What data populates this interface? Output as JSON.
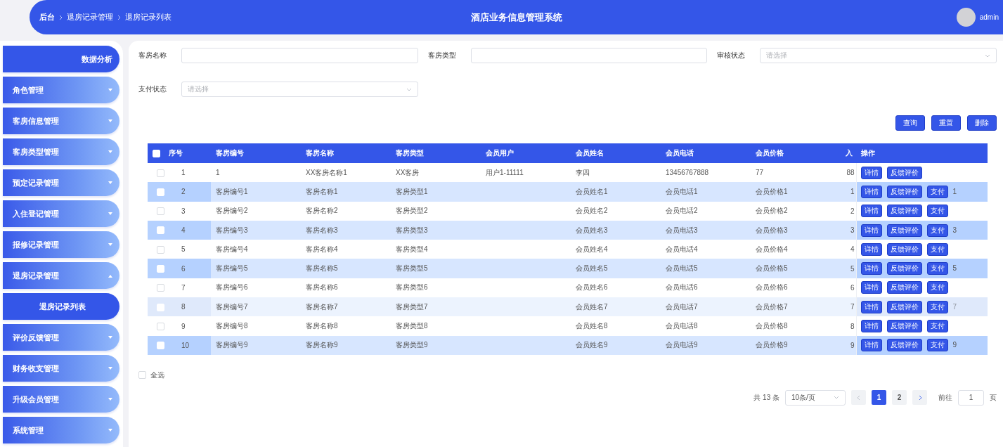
{
  "header": {
    "breadcrumbs": [
      "后台",
      "退房记录管理",
      "退房记录列表"
    ],
    "title": "酒店业务信息管理系统",
    "user": "admin"
  },
  "sidebar": {
    "items": [
      {
        "label": "数据分析",
        "kind": "link",
        "selected": false
      },
      {
        "label": "角色管理",
        "kind": "group",
        "expanded": false
      },
      {
        "label": "客房信息管理",
        "kind": "group",
        "expanded": false
      },
      {
        "label": "客房类型管理",
        "kind": "group",
        "expanded": false
      },
      {
        "label": "预定记录管理",
        "kind": "group",
        "expanded": false
      },
      {
        "label": "入住登记管理",
        "kind": "group",
        "expanded": false
      },
      {
        "label": "报修记录管理",
        "kind": "group",
        "expanded": false
      },
      {
        "label": "退房记录管理",
        "kind": "group",
        "expanded": true,
        "children": [
          {
            "label": "退房记录列表",
            "selected": true
          }
        ]
      },
      {
        "label": "评价反馈管理",
        "kind": "group",
        "expanded": false
      },
      {
        "label": "财务收支管理",
        "kind": "group",
        "expanded": false
      },
      {
        "label": "升级会员管理",
        "kind": "group",
        "expanded": false
      },
      {
        "label": "系统管理",
        "kind": "group",
        "expanded": false
      }
    ]
  },
  "filters": [
    {
      "label": "客房名称",
      "kind": "input"
    },
    {
      "label": "客房类型",
      "kind": "input"
    },
    {
      "label": "审核状态",
      "kind": "select",
      "placeholder": "请选择"
    },
    {
      "label": "支付状态",
      "kind": "select",
      "placeholder": "请选择"
    }
  ],
  "actions": [
    "查询",
    "重置",
    "删除"
  ],
  "table": {
    "all_checked": false,
    "columns": [
      "序号",
      "客房编号",
      "客房名称",
      "客房类型",
      "会员用户",
      "会员姓名",
      "会员电话",
      "会员价格",
      "入",
      "操作"
    ],
    "rows": [
      {
        "seq": "1",
        "room_no": "1",
        "room_name": "XX客房名称1",
        "room_type": "XX客房",
        "member_user": "用户1-11111",
        "member_name": "李四",
        "member_phone": "13456767888",
        "member_price": "77",
        "check_in": "88",
        "buttons": [
          "详情",
          "反馈评价"
        ],
        "highlighted": false,
        "hovered": false
      },
      {
        "seq": "2",
        "room_no": "客房编号1",
        "room_name": "客房名称1",
        "room_type": "客房类型1",
        "member_name": "会员姓名1",
        "member_phone": "会员电话1",
        "member_price": "会员价格1",
        "check_in": "1",
        "buttons": [
          "详情",
          "反馈评价",
          "支付"
        ],
        "tail": "1",
        "highlighted": true,
        "hovered": false
      },
      {
        "seq": "3",
        "room_no": "客房编号2",
        "room_name": "客房名称2",
        "room_type": "客房类型2",
        "member_name": "会员姓名2",
        "member_phone": "会员电话2",
        "member_price": "会员价格2",
        "check_in": "2",
        "buttons": [
          "详情",
          "反馈评价",
          "支付"
        ],
        "highlighted": false,
        "hovered": false
      },
      {
        "seq": "4",
        "room_no": "客房编号3",
        "room_name": "客房名称3",
        "room_type": "客房类型3",
        "member_name": "会员姓名3",
        "member_phone": "会员电话3",
        "member_price": "会员价格3",
        "check_in": "3",
        "buttons": [
          "详情",
          "反馈评价",
          "支付"
        ],
        "tail": "3",
        "highlighted": true,
        "hovered": false
      },
      {
        "seq": "5",
        "room_no": "客房编号4",
        "room_name": "客房名称4",
        "room_type": "客房类型4",
        "member_name": "会员姓名4",
        "member_phone": "会员电话4",
        "member_price": "会员价格4",
        "check_in": "4",
        "buttons": [
          "详情",
          "反馈评价",
          "支付"
        ],
        "highlighted": false,
        "hovered": false
      },
      {
        "seq": "6",
        "room_no": "客房编号5",
        "room_name": "客房名称5",
        "room_type": "客房类型5",
        "member_name": "会员姓名5",
        "member_phone": "会员电话5",
        "member_price": "会员价格5",
        "check_in": "5",
        "buttons": [
          "详情",
          "反馈评价",
          "支付"
        ],
        "tail": "5",
        "highlighted": true,
        "hovered": false
      },
      {
        "seq": "7",
        "room_no": "客房编号6",
        "room_name": "客房名称6",
        "room_type": "客房类型6",
        "member_name": "会员姓名6",
        "member_phone": "会员电话6",
        "member_price": "会员价格6",
        "check_in": "6",
        "buttons": [
          "详情",
          "反馈评价",
          "支付"
        ],
        "highlighted": false,
        "hovered": false
      },
      {
        "seq": "8",
        "room_no": "客房编号7",
        "room_name": "客房名称7",
        "room_type": "客房类型7",
        "member_name": "会员姓名7",
        "member_phone": "会员电话7",
        "member_price": "会员价格7",
        "check_in": "7",
        "buttons": [
          "详情",
          "反馈评价",
          "支付"
        ],
        "tail": "7",
        "highlighted": false,
        "hovered": true
      },
      {
        "seq": "9",
        "room_no": "客房编号8",
        "room_name": "客房名称8",
        "room_type": "客房类型8",
        "member_name": "会员姓名8",
        "member_phone": "会员电话8",
        "member_price": "会员价格8",
        "check_in": "8",
        "buttons": [
          "详情",
          "反馈评价",
          "支付"
        ],
        "highlighted": false,
        "hovered": false
      },
      {
        "seq": "10",
        "room_no": "客房编号9",
        "room_name": "客房名称9",
        "room_type": "客房类型9",
        "member_name": "会员姓名9",
        "member_phone": "会员电话9",
        "member_price": "会员价格9",
        "check_in": "9",
        "buttons": [
          "详情",
          "反馈评价",
          "支付"
        ],
        "tail": "9",
        "highlighted": true,
        "hovered": false
      }
    ]
  },
  "select_all": {
    "label": "全选",
    "checked": false
  },
  "pagination": {
    "total": "共 13 条",
    "page_size": "10条/页",
    "pages": [
      {
        "label": "1",
        "selected": true
      },
      {
        "label": "2",
        "selected": false
      }
    ],
    "goto_label": "前往",
    "goto_value": "1",
    "page_suffix": "页"
  }
}
